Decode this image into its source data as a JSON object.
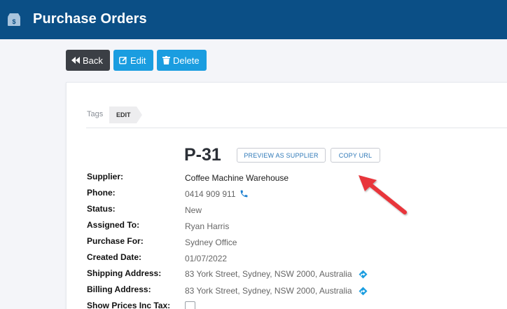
{
  "header": {
    "app_icon": "money-box-icon",
    "title": "Purchase Orders"
  },
  "toolbar": {
    "back_label": "Back",
    "edit_label": "Edit",
    "delete_label": "Delete"
  },
  "tags": {
    "label": "Tags",
    "items": [
      "EDIT"
    ]
  },
  "order": {
    "number": "P-31",
    "preview_label": "PREVIEW AS SUPPLIER",
    "copy_url_label": "COPY URL"
  },
  "details": {
    "supplier": {
      "label": "Supplier:",
      "value": "Coffee Machine Warehouse"
    },
    "phone": {
      "label": "Phone:",
      "value": "0414 909 911"
    },
    "status": {
      "label": "Status:",
      "value": "New"
    },
    "assigned_to": {
      "label": "Assigned To:",
      "value": "Ryan Harris"
    },
    "purchase_for": {
      "label": "Purchase For:",
      "value": "Sydney Office"
    },
    "created_date": {
      "label": "Created Date:",
      "value": "01/07/2022"
    },
    "shipping_address": {
      "label": "Shipping Address:",
      "value": "83 York Street, Sydney, NSW 2000, Australia"
    },
    "billing_address": {
      "label": "Billing Address:",
      "value": "83 York Street, Sydney, NSW 2000, Australia"
    },
    "show_prices_inc_tax": {
      "label": "Show Prices Inc Tax:",
      "checked": false
    }
  },
  "colors": {
    "header_bg": "#0b4f86",
    "primary_button": "#1a9de0",
    "dark_button": "#3b3f45",
    "annotation_arrow": "#e8353b"
  }
}
